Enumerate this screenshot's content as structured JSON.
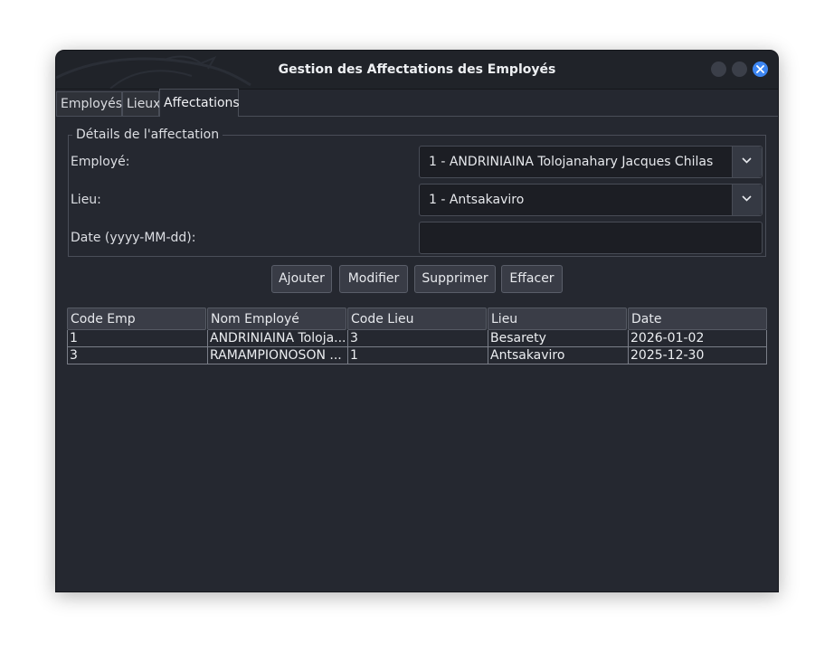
{
  "window": {
    "title": "Gestion des Affectations des Employés"
  },
  "tabs": [
    {
      "label": "Employés"
    },
    {
      "label": "Lieux"
    },
    {
      "label": "Affectations",
      "active": true
    }
  ],
  "form": {
    "group_title": "Détails de l'affectation",
    "employee_label": "Employé:",
    "employee_value": "1 - ANDRINIAINA Tolojanahary Jacques Chilas",
    "lieu_label": "Lieu:",
    "lieu_value": "1 - Antsakaviro",
    "date_label": "Date (yyyy-MM-dd):",
    "date_value": ""
  },
  "buttons": {
    "add": "Ajouter",
    "modify": "Modifier",
    "delete": "Supprimer",
    "clear": "Effacer"
  },
  "table": {
    "columns": [
      "Code Emp",
      "Nom Employé",
      "Code Lieu",
      "Lieu",
      "Date"
    ],
    "rows": [
      [
        "1",
        "ANDRINIAINA Toloja...",
        "3",
        "Besarety",
        "2026-01-02"
      ],
      [
        "3",
        "RAMAMPIONOSON ...",
        "1",
        "Antsakaviro",
        "2025-12-30"
      ]
    ]
  },
  "colors": {
    "accent": "#3d86f2",
    "window_bg": "#252830",
    "titlebar_bg": "#202329"
  }
}
